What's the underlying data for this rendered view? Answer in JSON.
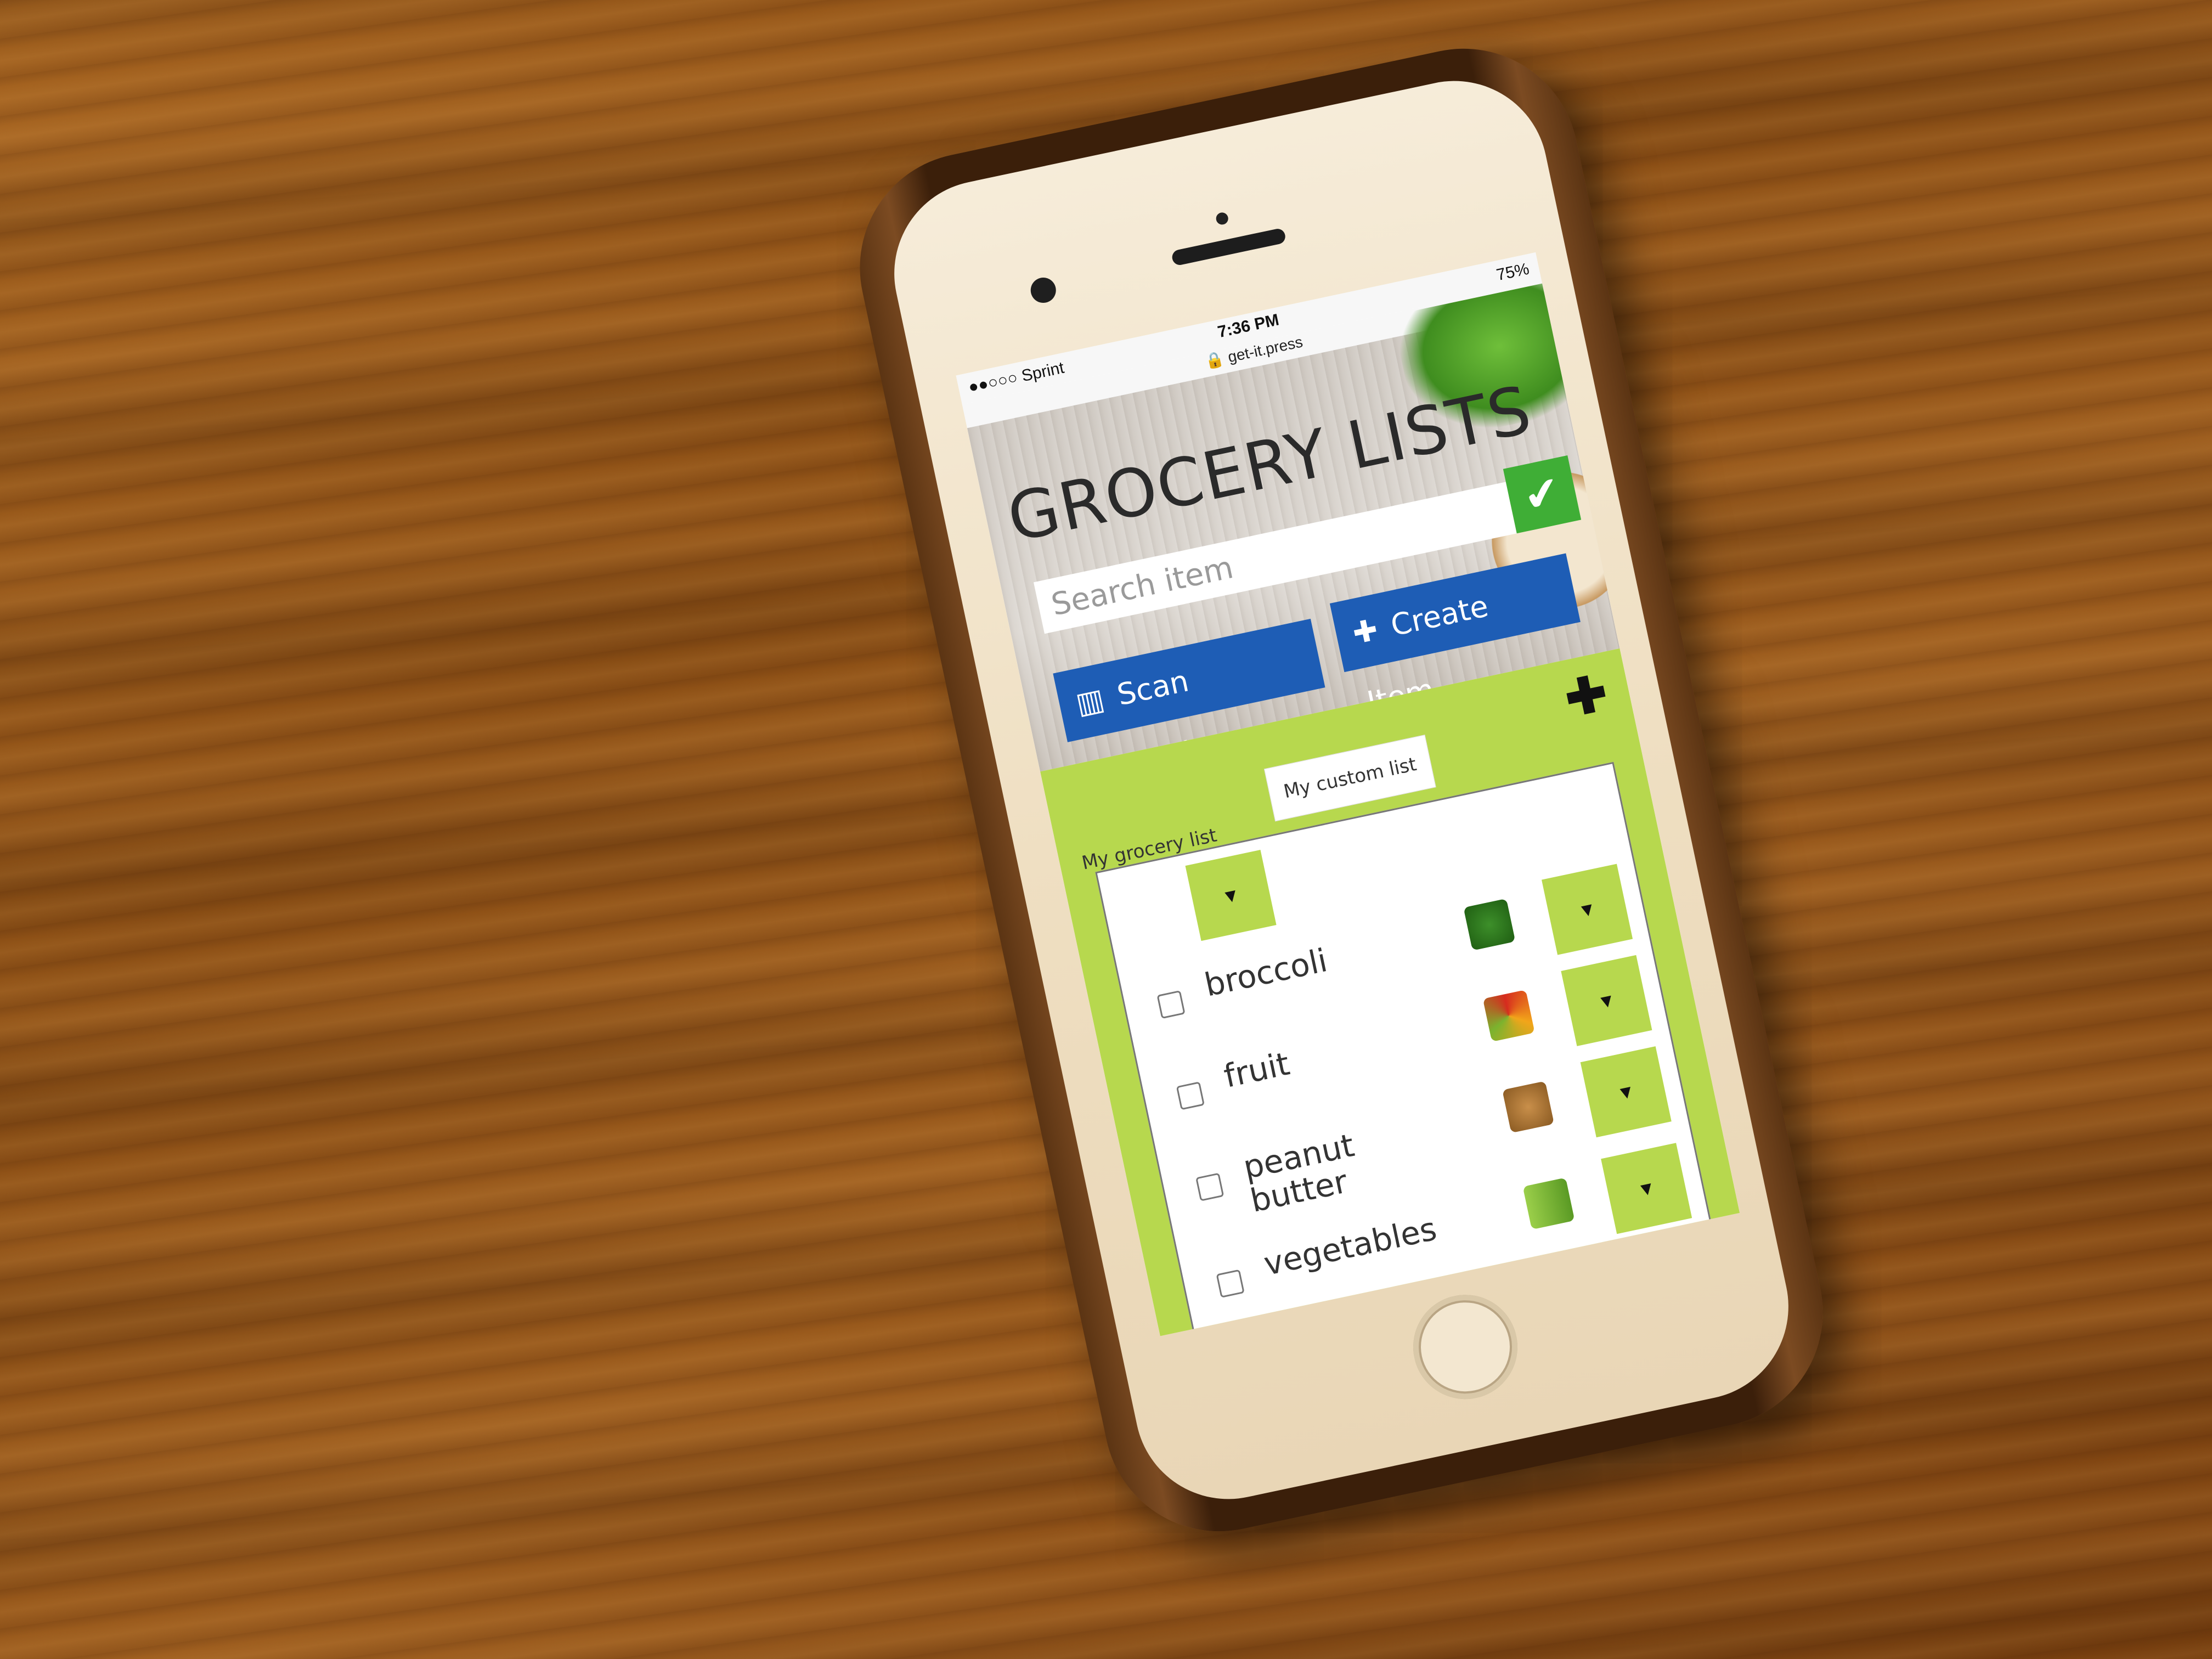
{
  "status_bar": {
    "carrier": "●●○○○ Sprint",
    "time": "7:36 PM",
    "battery": "75%"
  },
  "address_bar": {
    "url": "get-it.press"
  },
  "header": {
    "title": "GROCERY LISTS"
  },
  "search": {
    "placeholder": "Search item"
  },
  "buttons": {
    "scan_barcode": "Scan Barcode",
    "create_item": "Create Item"
  },
  "tabs": [
    {
      "label": "My grocery list"
    },
    {
      "label": "My custom list"
    }
  ],
  "list_items": [
    {
      "name": "broccoli",
      "icon": "broccoli-icon"
    },
    {
      "name": "fruit",
      "icon": "fruit-icon"
    },
    {
      "name": "peanut butter",
      "icon": "peanut-butter-icon"
    },
    {
      "name": "vegetables",
      "icon": "vegetables-icon"
    }
  ],
  "colors": {
    "accent_green": "#b7d84e",
    "button_blue": "#1e5db5",
    "confirm_green": "#3fae36"
  }
}
